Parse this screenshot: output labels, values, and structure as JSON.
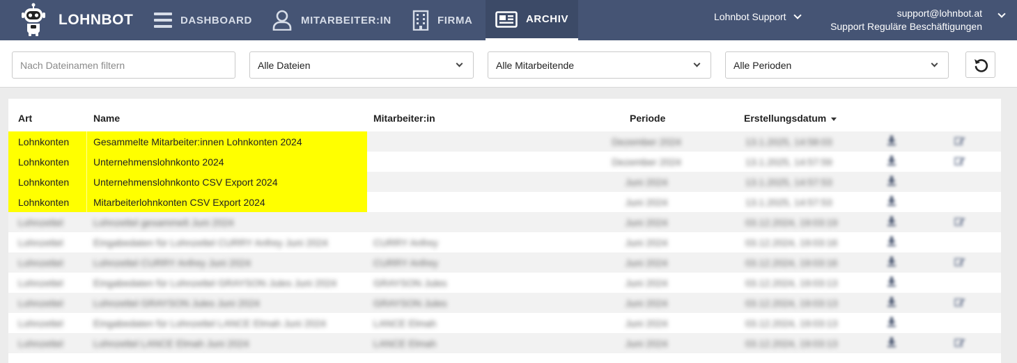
{
  "brand": {
    "name": "LOHNBOT"
  },
  "nav": {
    "dashboard": "DASHBOARD",
    "employees": "MITARBEITER:IN",
    "company": "FIRMA",
    "archive": "ARCHIV"
  },
  "support_menu": {
    "label": "Lohnbot Support"
  },
  "account": {
    "email": "support@lohnbot.at",
    "subtitle": "Support Reguläre Beschäftigungen"
  },
  "filters": {
    "filename_placeholder": "Nach Dateinamen filtern",
    "files": "Alle Dateien",
    "employees": "Alle Mitarbeitende",
    "periods": "Alle Perioden"
  },
  "table": {
    "headers": {
      "type": "Art",
      "name": "Name",
      "employee": "Mitarbeiter:in",
      "period": "Periode",
      "created": "Erstellungsdatum"
    },
    "rows": [
      {
        "type": "Lohnkonten",
        "name": "Gesammelte Mitarbeiter:innen Lohnkonten 2024",
        "employee": "",
        "period": "Dezember 2024",
        "created": "13.1.2025, 14:58:03",
        "download": true,
        "edit": true,
        "highlight": true
      },
      {
        "type": "Lohnkonten",
        "name": "Unternehmenslohnkonto 2024",
        "employee": "",
        "period": "Dezember 2024",
        "created": "13.1.2025, 14:57:59",
        "download": true,
        "edit": true,
        "highlight": true
      },
      {
        "type": "Lohnkonten",
        "name": "Unternehmenslohnkonto CSV Export 2024",
        "employee": "",
        "period": "Juni 2024",
        "created": "13.1.2025, 14:57:53",
        "download": true,
        "edit": false,
        "highlight": true
      },
      {
        "type": "Lohnkonten",
        "name": "Mitarbeiterlohnkonten CSV Export 2024",
        "employee": "",
        "period": "Juni 2024",
        "created": "13.1.2025, 14:57:53",
        "download": true,
        "edit": false,
        "highlight": true
      },
      {
        "type": "Lohnzettel",
        "name": "Lohnzettel gesammelt Juni 2024",
        "employee": "",
        "period": "Juni 2024",
        "created": "03.12.2024, 19:03:19",
        "download": true,
        "edit": true,
        "highlight": false
      },
      {
        "type": "Lohnzettel",
        "name": "Eingabedaten für Lohnzettel CURRY Anfrey Juni 2024",
        "employee": "CURRY Anfrey",
        "period": "Juni 2024",
        "created": "03.12.2024, 19:03:16",
        "download": true,
        "edit": false,
        "highlight": false
      },
      {
        "type": "Lohnzettel",
        "name": "Lohnzettel CURRY Anfrey Juni 2024",
        "employee": "CURRY Anfrey",
        "period": "Juni 2024",
        "created": "03.12.2024, 19:03:16",
        "download": true,
        "edit": true,
        "highlight": false
      },
      {
        "type": "Lohnzettel",
        "name": "Eingabedaten für Lohnzettel GRAYSON Jules Juni 2024",
        "employee": "GRAYSON Jules",
        "period": "Juni 2024",
        "created": "03.12.2024, 19:03:13",
        "download": true,
        "edit": false,
        "highlight": false
      },
      {
        "type": "Lohnzettel",
        "name": "Lohnzettel GRAYSON Jules Juni 2024",
        "employee": "GRAYSON Jules",
        "period": "Juni 2024",
        "created": "03.12.2024, 19:03:13",
        "download": true,
        "edit": true,
        "highlight": false
      },
      {
        "type": "Lohnzettel",
        "name": "Eingabedaten für Lohnzettel LANCE Elmah Juni 2024",
        "employee": "LANCE Elmah",
        "period": "Juni 2024",
        "created": "03.12.2024, 19:03:13",
        "download": true,
        "edit": false,
        "highlight": false
      },
      {
        "type": "Lohnzettel",
        "name": "Lohnzettel LANCE Elmah Juni 2024",
        "employee": "LANCE Elmah",
        "period": "Juni 2024",
        "created": "03.12.2024, 19:03:13",
        "download": true,
        "edit": true,
        "highlight": false
      }
    ]
  },
  "icons": {
    "reset": "reset-icon",
    "download": "download-icon",
    "edit": "edit-icon"
  },
  "colors": {
    "topbar": "#455474",
    "highlight": "#ffff00"
  }
}
